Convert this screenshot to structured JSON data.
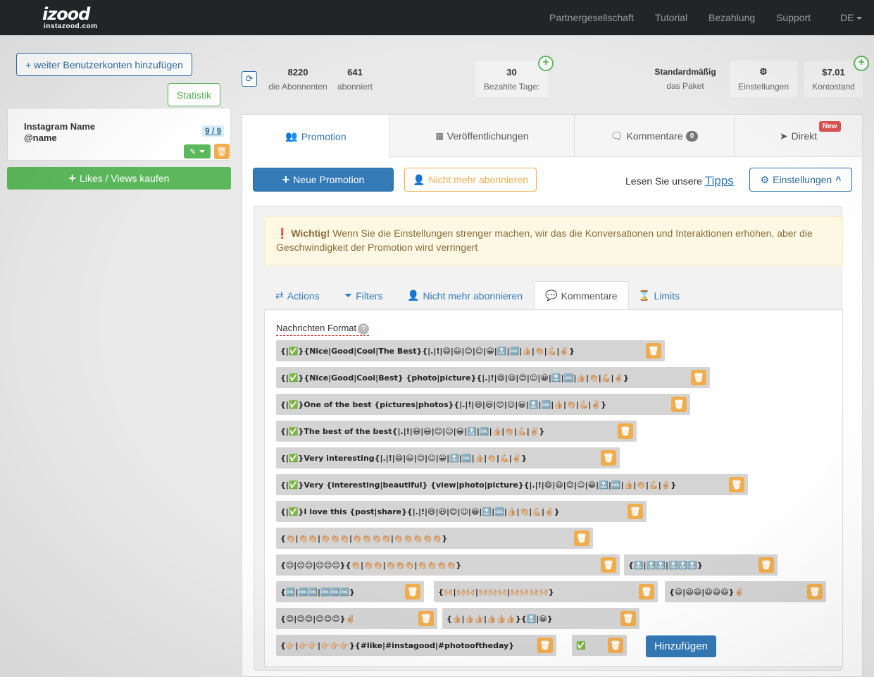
{
  "navbar": {
    "logo_main": "izood",
    "logo_sub": "instazood.com",
    "links": [
      "Partnergesellschaft",
      "Tutorial",
      "Bezahlung",
      "Support"
    ],
    "language": "DE"
  },
  "sidebar": {
    "add_accounts_label": "+ weiter Benutzerkonten hinzufügen",
    "stats_label": "Statistik",
    "account": {
      "name": "Instagram Name",
      "handle": "@name",
      "count": "9 / 9"
    },
    "buy_label": "Likes / Views kaufen"
  },
  "stats": {
    "followers": {
      "value": "8220",
      "label": "die Abonnenten"
    },
    "following": {
      "value": "641",
      "label": "abonniert"
    },
    "paid_days": {
      "value": "30",
      "label": "Bezahlte Tage:"
    },
    "package": {
      "value": "Standardmäßig",
      "label": "das Paket"
    },
    "settings": {
      "label": "Einstellungen"
    },
    "balance": {
      "value": "$7.01",
      "label": "Kontostand"
    }
  },
  "main_tabs": [
    {
      "label": "Promotion",
      "icon": "users-icon"
    },
    {
      "label": "Veröffentlichungen",
      "icon": "grid-icon"
    },
    {
      "label": "Kommentare",
      "icon": "comments-icon",
      "badge": "0"
    },
    {
      "label": "Direkt",
      "icon": "send-icon",
      "badge": "New"
    }
  ],
  "toolbar": {
    "new_promotion": "Neue Promotion",
    "unfollow": "Nicht mehr abonnieren",
    "tips_prefix": "Lesen Sie unsere",
    "tips_link": "Tipps",
    "settings": "Einstellungen"
  },
  "alert": {
    "title": "Wichtig!",
    "text": "Wenn Sie die Einstellungen strenger machen, wir das die Konversationen und Interaktionen erhöhen, aber die Geschwindigkeit der Promotion wird verringert"
  },
  "settings_tabs": [
    {
      "label": "Actions",
      "icon": "exchange-icon"
    },
    {
      "label": "Filters",
      "icon": "filter-icon"
    },
    {
      "label": "Nicht mehr abonnieren",
      "icon": "user-times-icon"
    },
    {
      "label": "Kommentare",
      "icon": "comment-icon"
    },
    {
      "label": "Limits",
      "icon": "hourglass-icon"
    }
  ],
  "comments": {
    "format_label": "Nachrichten Format",
    "add_label": "Hinzufügen",
    "rows": [
      [
        "{|✅}{Nice|Good|Cool|The Best}{|.|!|😄|😃|😊|☺|😀|🔝|🆒|👍🏼|👏🏼|💪🏼|✌🏼}"
      ],
      [
        "{|✅}{Nice|Good|Cool|Best} {photo|picture}{|.|!|😄|😃|😊|☺|😀|🔝|🆒|👍🏼|👏🏼|💪🏼|✌🏼}"
      ],
      [
        "{|✅}One of the best {pictures|photos}{|.|!|😄|😃|😊|☺|😀|🔝|🆒|👍🏼|👏🏼|💪🏼|✌🏼}"
      ],
      [
        "{|✅}The best of the best{|.|!|😄|😃|😊|☺|😀|🔝|🆒|👍🏼|👏🏼|💪🏼|✌🏼}"
      ],
      [
        "{|✅}Very interesting{|.|!|😄|😃|😊|☺|😀|🔝|🆒|👍🏼|👏🏼|💪🏼|✌🏼}"
      ],
      [
        "{|✅}Very {interesting|beautiful} {view|photo|picture}{|.|!|😄|😃|😊|☺|😀|🔝|🆒|👍🏼|👏🏼|💪🏼|✌🏼}"
      ],
      [
        "{|✅}I love this {post|share}{|.|!|😄|😃|😊|☺|😀|🔝|🆒|👍🏼|👏🏼|💪🏼|✌🏼}"
      ],
      [
        "{👏🏼|👏🏼👏🏼|👏🏼👏🏼👏🏼|👏🏼👏🏼👏🏼👏🏼|👏🏼👏🏼👏🏼👏🏼👏🏼}"
      ],
      [
        "{😊|😊😊|😊😊😊}{👏🏼|👏🏼👏🏼|👏🏼👏🏼👏🏼|👏🏼👏🏼👏🏼👏🏼}",
        "{🔝|🔝🔝|🔝🔝🔝}"
      ],
      [
        "{🆒|🆒🆒|🆒🆒🆒}",
        "{🙌🏼|🙌🏼🙌🏼|🙌🏼🙌🏼🙌🏼|🙌🏼🙌🏼🙌🏼🙌🏼}",
        "{😃|😃😃|😃😃😃}✌🏼"
      ],
      [
        "{😊|😊😊|😊😊😊}✌🏼",
        "{👍🏼|👍🏼👍🏼|👍🏼👍🏼👍🏼}{🔝|😀}"
      ],
      [
        "{👉🏼|👉🏼👉🏼|👉🏼👉🏼👉🏼}{#like|#instagood|#photooftheday}",
        "✅"
      ]
    ]
  },
  "colors": {
    "navbar": "#212528",
    "primary": "#337ab7",
    "success": "#5cb85c",
    "warning": "#f0ad4e",
    "danger": "#d9534f"
  }
}
